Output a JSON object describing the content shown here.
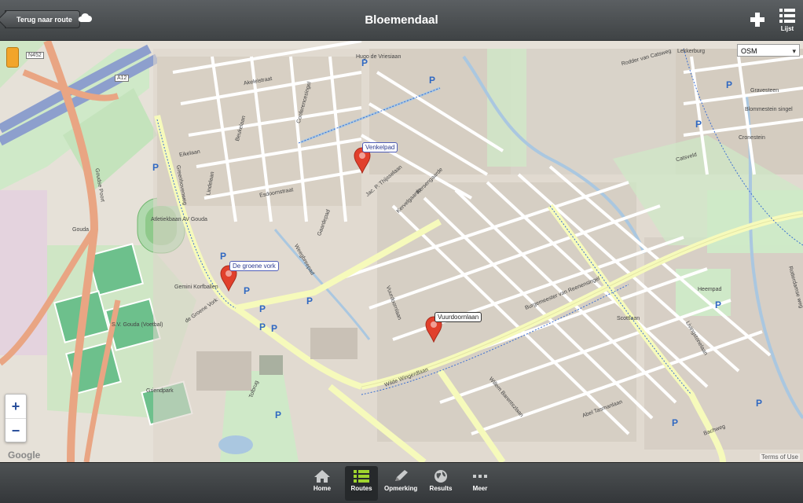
{
  "header": {
    "back_label": "Terug naar route",
    "title": "Bloemendaal",
    "list_label": "Lijst"
  },
  "map": {
    "layer_select": "OSM",
    "attribution": "Terms of Use",
    "provider_logo": "Google",
    "zoom_in": "+",
    "zoom_out": "−",
    "pois": [
      {
        "label": "Venkelpad"
      },
      {
        "label": "De groene vork"
      },
      {
        "label": "Vuurdoornlaan"
      }
    ],
    "streets": {
      "s1": "Hugo de Vriesiaan",
      "s2": "Akeleistraat",
      "s3": "Conferencesingel",
      "s4": "Beukelaan",
      "s5": "Eikelaan",
      "s6": "Lindelaan",
      "s7": "Esdoornstraat",
      "s8": "Gaardepad",
      "s9": "Weegbreepad",
      "s10": "Jac. P. Thijsselaan",
      "s11": "Kervelgaarde",
      "s12": "Kersengaarde",
      "s13": "Goudse Poort",
      "s14": "Gouda",
      "s15": "Atletiekbaan AV Gouda",
      "s16": "Gemini Korfballen",
      "s17": "S.V. Gouda (Voetbal)",
      "s18": "de Groene Vork",
      "s19": "Burgemeester van Reenensingel",
      "s20": "Vuurdoornlaan",
      "s21": "Wilde Wingerdlaan",
      "s22": "Heempad",
      "s23": "Rotterdamse weg",
      "s24": "Livingstonelaan",
      "s25": "Scottlaan",
      "s26": "Willem Barentszlaan",
      "s27": "Abel Tasmanlaan",
      "s28": "Bachweg",
      "s29": "Blommestein singel",
      "s30": "Cronestein",
      "s31": "Gravesteen",
      "s32": "Rodder van Catsweg",
      "s33": "Lekkerburg",
      "s34": "Catsveld",
      "s35": "Tolbrug",
      "s36": "Greenhovenweg",
      "s37": "Griendpark",
      "s38": "A12",
      "s39": "N452"
    }
  },
  "footer": {
    "tabs": [
      {
        "label": "Home",
        "icon": "home-icon"
      },
      {
        "label": "Routes",
        "icon": "list-icon"
      },
      {
        "label": "Opmerking",
        "icon": "pencil-icon"
      },
      {
        "label": "Results",
        "icon": "globe-icon"
      },
      {
        "label": "Meer",
        "icon": "more-icon"
      }
    ]
  },
  "colors": {
    "poi_marker": "#e1402c",
    "road_major": "#f6fabb",
    "water": "#aac7e0",
    "park": "#c9e8c3"
  }
}
